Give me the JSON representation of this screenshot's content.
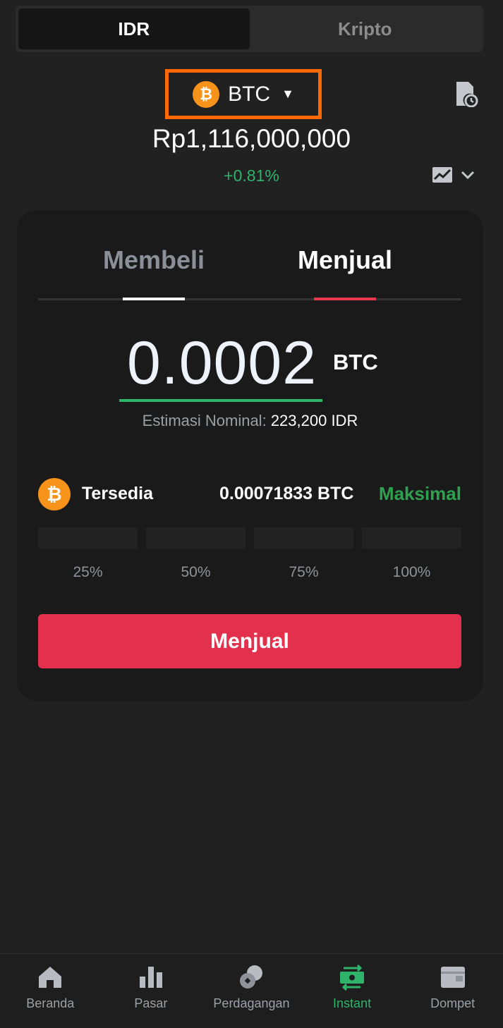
{
  "toggle": {
    "idr_label": "IDR",
    "crypto_label": "Kripto"
  },
  "coin": {
    "name": "BTC",
    "icon_symbol": "₿"
  },
  "price": {
    "value": "Rp1,116,000,000",
    "change": "+0.81%"
  },
  "trade": {
    "tab_buy": "Membeli",
    "tab_sell": "Menjual",
    "amount": "0.0002",
    "unit": "BTC",
    "estimate_label": "Estimasi Nominal:",
    "estimate_value": "223,200 IDR",
    "available_label": "Tersedia",
    "available_amount": "0.00071833 BTC",
    "max_label": "Maksimal",
    "percent_options": [
      "25%",
      "50%",
      "75%",
      "100%"
    ],
    "sell_button": "Menjual"
  },
  "nav": {
    "items": [
      {
        "label": "Beranda",
        "icon": "home-icon"
      },
      {
        "label": "Pasar",
        "icon": "bar-chart-icon"
      },
      {
        "label": "Perdagangan",
        "icon": "trade-icon"
      },
      {
        "label": "Instant",
        "icon": "instant-icon",
        "active": true
      },
      {
        "label": "Dompet",
        "icon": "wallet-icon"
      }
    ]
  },
  "colors": {
    "accent_green": "#2fb36b",
    "sell_red": "#e3304d",
    "btc_orange": "#f7931a",
    "highlight_orange": "#ff6a00"
  }
}
